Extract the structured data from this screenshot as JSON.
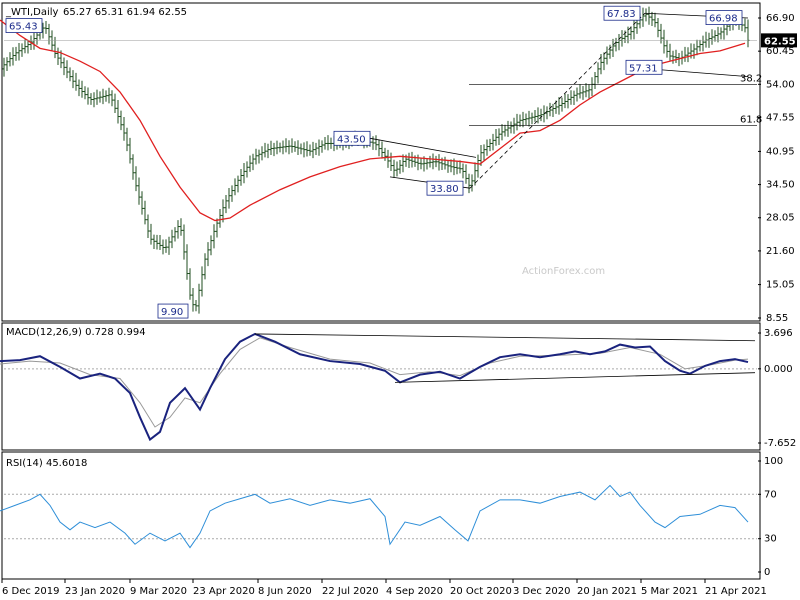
{
  "chart_data": {
    "type": "ohlc",
    "symbol_header": "_WTI,Daily",
    "ohlc_header": "65.27 65.31 61.94 62.55",
    "watermark": "ActionForex.com",
    "x_labels": [
      "6 Dec 2019",
      "23 Jan 2020",
      "9 Mar 2020",
      "23 Apr 2020",
      "8 Jun 2020",
      "22 Jul 2020",
      "4 Sep 2020",
      "20 Oct 2020",
      "3 Dec 2020",
      "20 Jan 2021",
      "5 Mar 2021",
      "21 Apr 2021"
    ],
    "price_panel": {
      "y_ticks": [
        "66.90",
        "60.45",
        "54.00",
        "47.55",
        "40.95",
        "34.50",
        "28.05",
        "21.60",
        "15.05",
        "8.55"
      ],
      "y_range": [
        8.55,
        66.9
      ],
      "current_price": "62.55",
      "price_points": [
        [
          0,
          57.0
        ],
        [
          15,
          60.0
        ],
        [
          30,
          62.0
        ],
        [
          45,
          65.4
        ],
        [
          55,
          60.0
        ],
        [
          75,
          54.0
        ],
        [
          90,
          51.0
        ],
        [
          110,
          52.0
        ],
        [
          125,
          44.0
        ],
        [
          135,
          35.0
        ],
        [
          150,
          24.0
        ],
        [
          165,
          22.0
        ],
        [
          180,
          27.0
        ],
        [
          190,
          13.0
        ],
        [
          195,
          9.9
        ],
        [
          205,
          20.0
        ],
        [
          215,
          26.0
        ],
        [
          225,
          31.0
        ],
        [
          240,
          36.0
        ],
        [
          255,
          40.0
        ],
        [
          270,
          41.5
        ],
        [
          290,
          42.0
        ],
        [
          310,
          41.0
        ],
        [
          325,
          42.5
        ],
        [
          340,
          42.5
        ],
        [
          355,
          43.5
        ],
        [
          375,
          42.5
        ],
        [
          385,
          40.0
        ],
        [
          395,
          37.0
        ],
        [
          405,
          39.5
        ],
        [
          420,
          38.5
        ],
        [
          435,
          39.0
        ],
        [
          450,
          38.0
        ],
        [
          462,
          37.5
        ],
        [
          470,
          33.9
        ],
        [
          480,
          40.5
        ],
        [
          500,
          44.5
        ],
        [
          520,
          47.0
        ],
        [
          540,
          48.0
        ],
        [
          560,
          50.0
        ],
        [
          575,
          52.0
        ],
        [
          590,
          53.0
        ],
        [
          600,
          58.0
        ],
        [
          615,
          62.0
        ],
        [
          630,
          64.0
        ],
        [
          645,
          67.8
        ],
        [
          655,
          66.0
        ],
        [
          665,
          61.0
        ],
        [
          670,
          59.5
        ],
        [
          680,
          59.0
        ],
        [
          695,
          61.0
        ],
        [
          705,
          62.5
        ],
        [
          720,
          64.0
        ],
        [
          735,
          66.8
        ],
        [
          745,
          65.0
        ],
        [
          748,
          62.55
        ]
      ],
      "ma_points": [
        [
          0,
          66.5
        ],
        [
          20,
          63.5
        ],
        [
          40,
          61.0
        ],
        [
          60,
          60.2
        ],
        [
          80,
          58.5
        ],
        [
          100,
          56.5
        ],
        [
          120,
          52.5
        ],
        [
          140,
          47.0
        ],
        [
          160,
          40.0
        ],
        [
          180,
          34.0
        ],
        [
          200,
          29.0
        ],
        [
          215,
          27.5
        ],
        [
          230,
          28.0
        ],
        [
          250,
          30.5
        ],
        [
          280,
          33.5
        ],
        [
          310,
          36.0
        ],
        [
          340,
          38.0
        ],
        [
          370,
          39.5
        ],
        [
          400,
          40.0
        ],
        [
          430,
          39.5
        ],
        [
          460,
          39.0
        ],
        [
          480,
          38.5
        ],
        [
          500,
          41.5
        ],
        [
          520,
          44.5
        ],
        [
          540,
          45.0
        ],
        [
          560,
          47.0
        ],
        [
          580,
          50.0
        ],
        [
          600,
          52.5
        ],
        [
          620,
          54.5
        ],
        [
          640,
          56.5
        ],
        [
          660,
          58.0
        ],
        [
          680,
          59.0
        ],
        [
          700,
          60.0
        ],
        [
          720,
          60.5
        ],
        [
          745,
          62.0
        ]
      ],
      "fib_levels": [
        {
          "label": "38.2",
          "price": 54.0
        },
        {
          "label": "61.8",
          "price": 46.0
        }
      ],
      "annotations": [
        {
          "label": "65.43",
          "price": 65.43
        },
        {
          "label": "9.90",
          "price": 9.9
        },
        {
          "label": "43.50",
          "price": 43.5
        },
        {
          "label": "33.80",
          "price": 33.8
        },
        {
          "label": "67.83",
          "price": 67.83
        },
        {
          "label": "66.98",
          "price": 66.98
        },
        {
          "label": "57.31",
          "price": 57.31
        }
      ]
    },
    "macd_panel": {
      "header": "MACD(12,26,9) 0.728 0.994",
      "y_ticks": [
        "3.696",
        "0.000",
        "-7.652"
      ],
      "y_range": [
        -7.652,
        3.696
      ],
      "macd_points": [
        [
          0,
          0.8
        ],
        [
          20,
          0.9
        ],
        [
          40,
          1.3
        ],
        [
          60,
          0.2
        ],
        [
          80,
          -1.0
        ],
        [
          100,
          -0.5
        ],
        [
          115,
          -1.0
        ],
        [
          130,
          -2.5
        ],
        [
          140,
          -5.0
        ],
        [
          150,
          -7.3
        ],
        [
          160,
          -6.5
        ],
        [
          170,
          -3.5
        ],
        [
          185,
          -2.0
        ],
        [
          200,
          -4.2
        ],
        [
          210,
          -2.0
        ],
        [
          225,
          1.0
        ],
        [
          240,
          2.8
        ],
        [
          255,
          3.6
        ],
        [
          275,
          2.8
        ],
        [
          300,
          1.5
        ],
        [
          330,
          0.8
        ],
        [
          360,
          0.5
        ],
        [
          385,
          -0.2
        ],
        [
          400,
          -1.4
        ],
        [
          420,
          -0.6
        ],
        [
          440,
          -0.3
        ],
        [
          460,
          -1.0
        ],
        [
          480,
          0.2
        ],
        [
          500,
          1.2
        ],
        [
          520,
          1.5
        ],
        [
          540,
          1.2
        ],
        [
          560,
          1.5
        ],
        [
          575,
          1.8
        ],
        [
          590,
          1.5
        ],
        [
          605,
          1.8
        ],
        [
          620,
          2.5
        ],
        [
          635,
          2.2
        ],
        [
          650,
          2.3
        ],
        [
          665,
          0.8
        ],
        [
          680,
          -0.2
        ],
        [
          690,
          -0.5
        ],
        [
          705,
          0.3
        ],
        [
          720,
          0.8
        ],
        [
          735,
          1.0
        ],
        [
          748,
          0.7
        ]
      ],
      "signal_points": [
        [
          0,
          0.5
        ],
        [
          30,
          0.8
        ],
        [
          60,
          0.6
        ],
        [
          90,
          -0.6
        ],
        [
          120,
          -1.0
        ],
        [
          140,
          -3.5
        ],
        [
          155,
          -6.0
        ],
        [
          170,
          -5.0
        ],
        [
          185,
          -3.0
        ],
        [
          200,
          -3.5
        ],
        [
          220,
          -0.5
        ],
        [
          240,
          2.0
        ],
        [
          260,
          3.2
        ],
        [
          290,
          2.2
        ],
        [
          330,
          1.0
        ],
        [
          370,
          0.6
        ],
        [
          400,
          -0.6
        ],
        [
          430,
          -0.3
        ],
        [
          460,
          -0.7
        ],
        [
          490,
          0.6
        ],
        [
          520,
          1.3
        ],
        [
          560,
          1.4
        ],
        [
          600,
          1.6
        ],
        [
          630,
          2.2
        ],
        [
          660,
          1.5
        ],
        [
          685,
          0.0
        ],
        [
          710,
          0.4
        ],
        [
          735,
          0.9
        ],
        [
          748,
          1.0
        ]
      ]
    },
    "rsi_panel": {
      "header": "RSI(14) 45.6018",
      "y_ticks": [
        "100",
        "70",
        "30",
        "0"
      ],
      "y_range": [
        0,
        100
      ],
      "rsi_points": [
        [
          0,
          55
        ],
        [
          15,
          60
        ],
        [
          30,
          65
        ],
        [
          40,
          70
        ],
        [
          50,
          60
        ],
        [
          60,
          45
        ],
        [
          70,
          38
        ],
        [
          80,
          45
        ],
        [
          95,
          40
        ],
        [
          110,
          45
        ],
        [
          125,
          35
        ],
        [
          135,
          25
        ],
        [
          150,
          35
        ],
        [
          165,
          28
        ],
        [
          180,
          35
        ],
        [
          190,
          22
        ],
        [
          200,
          35
        ],
        [
          210,
          55
        ],
        [
          225,
          62
        ],
        [
          240,
          66
        ],
        [
          255,
          70
        ],
        [
          270,
          62
        ],
        [
          290,
          66
        ],
        [
          310,
          60
        ],
        [
          330,
          65
        ],
        [
          350,
          62
        ],
        [
          370,
          66
        ],
        [
          385,
          50
        ],
        [
          390,
          25
        ],
        [
          405,
          45
        ],
        [
          420,
          42
        ],
        [
          440,
          50
        ],
        [
          455,
          38
        ],
        [
          468,
          28
        ],
        [
          480,
          55
        ],
        [
          500,
          65
        ],
        [
          520,
          65
        ],
        [
          540,
          62
        ],
        [
          560,
          68
        ],
        [
          580,
          72
        ],
        [
          595,
          65
        ],
        [
          610,
          78
        ],
        [
          620,
          68
        ],
        [
          630,
          72
        ],
        [
          640,
          60
        ],
        [
          655,
          45
        ],
        [
          665,
          40
        ],
        [
          680,
          50
        ],
        [
          700,
          52
        ],
        [
          720,
          60
        ],
        [
          735,
          58
        ],
        [
          748,
          45
        ]
      ]
    }
  }
}
